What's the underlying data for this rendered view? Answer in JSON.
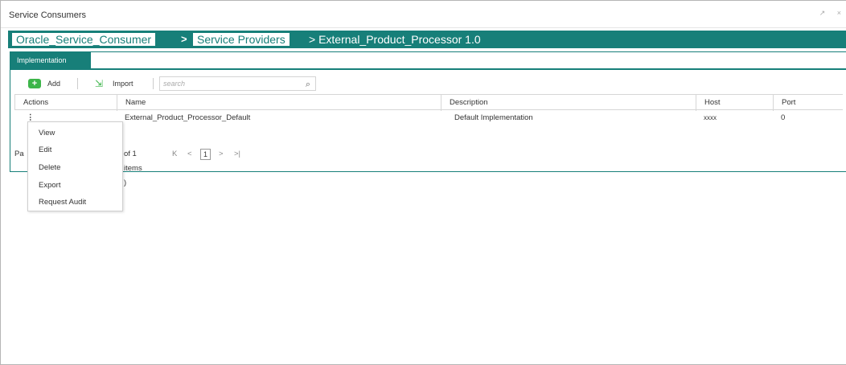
{
  "window": {
    "title": "Service Consumers",
    "controls": "↗ ×"
  },
  "breadcrumb": {
    "items": [
      "Oracle_Service_Consumer",
      "Service Providers"
    ],
    "separator": ">",
    "current": "> External_Product_Processor 1.0"
  },
  "tabs": [
    {
      "label": "Implementation"
    }
  ],
  "toolbar": {
    "add_label": "Add",
    "add_icon": "plus-icon",
    "import_label": "Import",
    "import_icon": "import-icon",
    "search_placeholder": "search",
    "search_icon": "magnifier-icon"
  },
  "table": {
    "columns": [
      "Actions",
      "Name",
      "Description",
      "Host",
      "Port"
    ],
    "rows": [
      {
        "actions": "⋮",
        "name": "External_Product_Processor_Default",
        "description": "Default Implementation",
        "host": "xxxx",
        "port": "0"
      }
    ]
  },
  "pager": {
    "prefix": "Pa",
    "summary": "of 1 items )",
    "first": "K",
    "prev": "<",
    "current_page": "1",
    "next": ">",
    "last": ">|"
  },
  "context_menu": {
    "items": [
      "View",
      "Edit",
      "Delete",
      "Export",
      "Request Audit"
    ]
  },
  "colors": {
    "accent": "#177f79",
    "add_green": "#3db54a"
  }
}
